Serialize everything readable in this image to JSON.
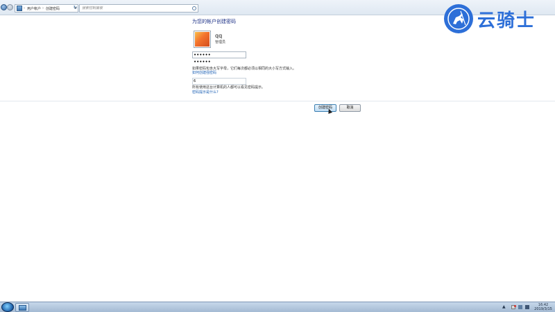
{
  "address_bar": {
    "breadcrumbs": [
      "用户帐户",
      "创建密码"
    ],
    "search_placeholder": "搜索控制面板"
  },
  "logo": {
    "brand_text": "云骑士",
    "brand_color": "#2d6fd8"
  },
  "panel": {
    "title": "为您的帐户创建密码",
    "user": {
      "name": "qq",
      "role": "管理员"
    },
    "password_value": "••••••",
    "confirm_value": "••••••",
    "caps_note": "如果密码包含大写字母，它们每次都必须以相同的大小写方式输入。",
    "strong_password_link": "如何创建强密码",
    "hint_value": "6",
    "hint_note": "所有使用这台计算机的人都可以看见密码提示。",
    "hint_help_link": "密码提示是什么?"
  },
  "buttons": {
    "create_label": "创建密码",
    "cancel_label": "取消"
  },
  "taskbar": {
    "time": "16:42",
    "date": "2019/3/15"
  }
}
